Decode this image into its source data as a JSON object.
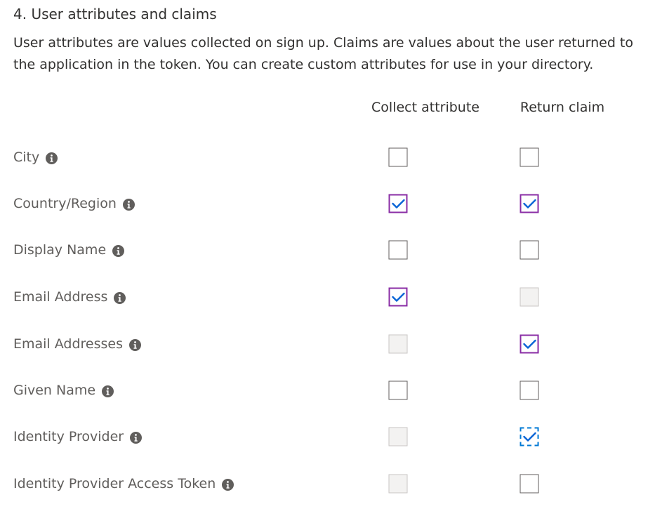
{
  "section": {
    "title": "4. User attributes and claims",
    "description": "User attributes are values collected on sign up. Claims are values about the user returned to the application in the token. You can create custom attributes for use in your directory."
  },
  "columns": {
    "collect": "Collect attribute",
    "claim": "Return claim"
  },
  "colors": {
    "checked_border": "#8a2da5",
    "checkmark": "#0a64d6",
    "disabled_fill": "#f3f2f1",
    "focus_outline": "#0078d4"
  },
  "rows": [
    {
      "label": "City",
      "icon": "info-icon",
      "collect": "unchecked",
      "claim": "unchecked"
    },
    {
      "label": "Country/Region",
      "icon": "info-icon",
      "collect": "checked",
      "claim": "checked"
    },
    {
      "label": "Display Name",
      "icon": "info-icon",
      "collect": "unchecked",
      "claim": "unchecked"
    },
    {
      "label": "Email Address",
      "icon": "info-icon",
      "collect": "checked",
      "claim": "disabled"
    },
    {
      "label": "Email Addresses",
      "icon": "info-icon",
      "collect": "disabled",
      "claim": "checked"
    },
    {
      "label": "Given Name",
      "icon": "info-icon",
      "collect": "unchecked",
      "claim": "unchecked"
    },
    {
      "label": "Identity Provider",
      "icon": "info-icon",
      "collect": "disabled",
      "claim": "checked-focused"
    },
    {
      "label": "Identity Provider Access Token",
      "icon": "info-icon",
      "collect": "disabled",
      "claim": "unchecked"
    }
  ]
}
